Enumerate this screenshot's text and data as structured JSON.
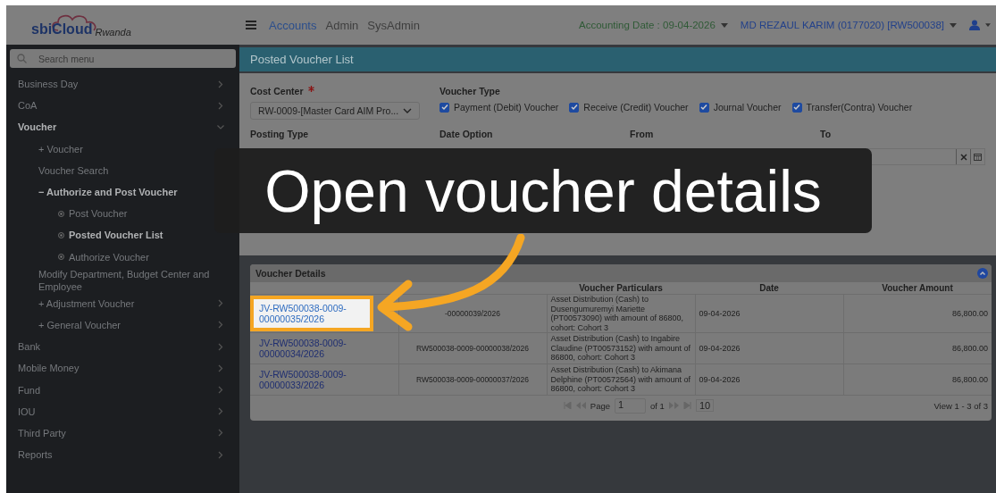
{
  "header": {
    "logo": {
      "name": "sbiCloud",
      "region": "Rwanda"
    },
    "nav": [
      {
        "label": "Accounts",
        "selected": true
      },
      {
        "label": "Admin",
        "selected": false
      },
      {
        "label": "SysAdmin",
        "selected": false
      }
    ],
    "accounting_date": "Accounting Date : 09-04-2026",
    "user": "MD REZAUL KARIM (0177020) [RW500038]"
  },
  "sidebar": {
    "search": {
      "placeholder": "Search menu"
    },
    "items": [
      {
        "label": "Business Day",
        "expanded": false,
        "selected": false
      },
      {
        "label": "CoA",
        "expanded": false,
        "selected": false
      },
      {
        "label": "Voucher",
        "expanded": true,
        "selected": true,
        "children": [
          {
            "label": "+ Voucher",
            "selected": false
          },
          {
            "label": "Voucher Search",
            "selected": false
          },
          {
            "label": "− Authorize and Post Voucher",
            "selected": true,
            "children": [
              {
                "label": "Post Voucher",
                "selected": false
              },
              {
                "label": "Posted Voucher List",
                "selected": true
              },
              {
                "label": "Authorize Voucher",
                "selected": false
              }
            ]
          },
          {
            "label": "Modify Department, Budget Center and Employee",
            "selected": false
          },
          {
            "label": "+ Adjustment Voucher",
            "expanded": false,
            "selected": false
          },
          {
            "label": "+ General Voucher",
            "expanded": false,
            "selected": false
          }
        ]
      },
      {
        "label": "Bank",
        "expanded": false,
        "selected": false
      },
      {
        "label": "Mobile Money",
        "expanded": false,
        "selected": false
      },
      {
        "label": "Fund",
        "expanded": false,
        "selected": false
      },
      {
        "label": "IOU",
        "expanded": false,
        "selected": false
      },
      {
        "label": "Third Party",
        "expanded": false,
        "selected": false
      },
      {
        "label": "Reports",
        "expanded": false,
        "selected": false
      }
    ]
  },
  "page_title": "Posted Voucher List",
  "filters": {
    "cost_center": {
      "label": "Cost Center",
      "required": true,
      "value": "RW-0009-[Master Card AIM Pro..."
    },
    "voucher_type": {
      "label": "Voucher Type",
      "options": [
        {
          "label": "Payment (Debit) Voucher",
          "checked": true
        },
        {
          "label": "Receive (Credit) Voucher",
          "checked": true
        },
        {
          "label": "Journal Voucher",
          "checked": true
        },
        {
          "label": "Transfer(Contra) Voucher",
          "checked": true
        }
      ]
    },
    "posting_type_label": "Posting Type",
    "date_option_label": "Date Option",
    "from_label": "From",
    "to_label": "To"
  },
  "voucher_details": {
    "title": "Voucher Details",
    "columns": [
      "",
      "",
      "Voucher Particulars",
      "Date",
      "Voucher Amount"
    ],
    "rows": [
      {
        "highlighted": true,
        "cells": [
          "JV-RW500038-0009-00000035/2026",
          "-00000039/2026",
          "Asset Distribution (Cash) to Dusengumuremyi Mariette (PT00573090) with amount of 86800, cohort: Cohort 3",
          "09-04-2026",
          "86,800.00"
        ]
      },
      {
        "highlighted": false,
        "cells": [
          "JV-RW500038-0009-00000034/2026",
          "RW500038-0009-00000038/2026",
          "Asset Distribution (Cash) to Ingabire Claudine (PT00573152) with amount of 86800, cohort: Cohort 3",
          "09-04-2026",
          "86,800.00"
        ]
      },
      {
        "highlighted": false,
        "cells": [
          "JV-RW500038-0009-00000033/2026",
          "RW500038-0009-00000037/2026",
          "Asset Distribution (Cash) to Akimana Delphine (PT00572564) with amount of 86800, cohort: Cohort 3",
          "09-04-2026",
          "86,800.00"
        ]
      }
    ],
    "pager": {
      "page_label": "Page",
      "page": "1",
      "of": "of 1",
      "page_size": "10",
      "view": "View 1 - 3 of 3"
    }
  },
  "caption": "Open voucher details"
}
